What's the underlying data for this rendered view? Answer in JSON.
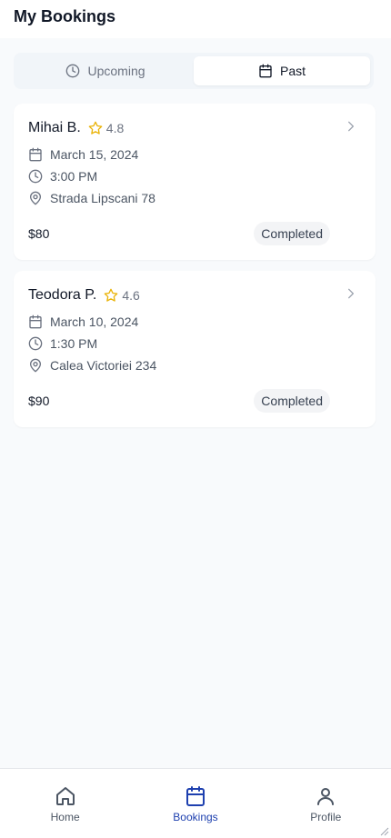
{
  "header": {
    "title": "My Bookings"
  },
  "tabs": [
    {
      "label": "Upcoming",
      "icon": "clock-icon",
      "active": false
    },
    {
      "label": "Past",
      "icon": "calendar-icon",
      "active": true
    }
  ],
  "bookings": [
    {
      "name": "Mihai B.",
      "rating": "4.8",
      "date": "March 15, 2024",
      "time": "3:00 PM",
      "address": "Strada Lipscani 78",
      "price": "$80",
      "status": "Completed"
    },
    {
      "name": "Teodora P.",
      "rating": "4.6",
      "date": "March 10, 2024",
      "time": "1:30 PM",
      "address": "Calea Victoriei 234",
      "price": "$90",
      "status": "Completed"
    }
  ],
  "nav": [
    {
      "label": "Home",
      "icon": "home-icon",
      "active": false
    },
    {
      "label": "Bookings",
      "icon": "calendar-icon",
      "active": true
    },
    {
      "label": "Profile",
      "icon": "user-icon",
      "active": false
    }
  ],
  "colors": {
    "accent": "#1e40af",
    "star": "#eab308",
    "background": "#f8fafc"
  }
}
